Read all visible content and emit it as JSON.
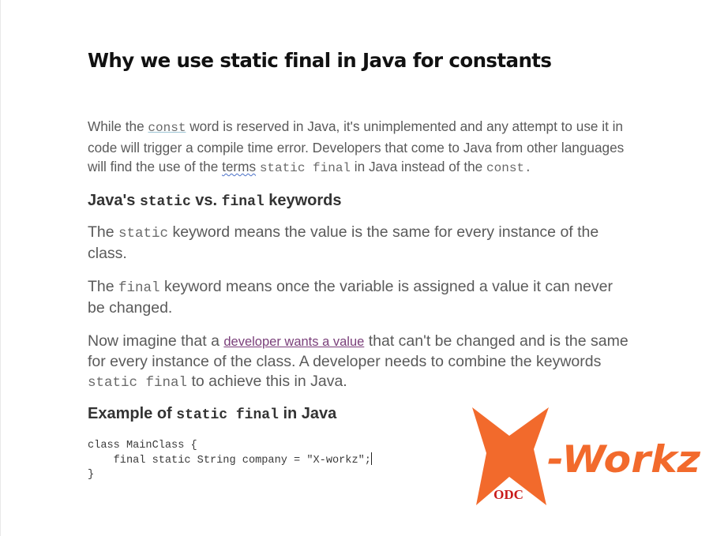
{
  "title": "Why we use static final in Java for constants",
  "intro": {
    "p1": "While the ",
    "const_link": "const",
    "p2": " word is reserved in Java, it's unimplemented and any attempt to use it in code will trigger a compile time error. Developers that come to Java from other languages will find the use of the ",
    "terms": "terms",
    "p3": " ",
    "static_final": "static final",
    "p4": " in Java instead of the ",
    "const_code": "const.",
    "p5": ""
  },
  "section1": {
    "h_prefix": "Java's ",
    "h_static": "static",
    "h_mid": " vs. ",
    "h_final": "final",
    "h_suffix": " keywords",
    "static_para": {
      "pre": "The ",
      "code": "static",
      "post": " keyword means the value is the same for every instance of the class."
    },
    "final_para": {
      "pre": "The ",
      "code": "final",
      "post": " keyword means once the variable is assigned a value it can never be changed."
    },
    "imagine_para": {
      "pre": "Now imagine that a ",
      "link": "developer wants a value",
      "mid": " that can't be changed and is the same for every instance of the class. A developer needs to combine the keywords ",
      "code": "static final",
      "post": " to achieve this in Java."
    }
  },
  "section2": {
    "h_prefix": "Example of ",
    "h_code": "static final",
    "h_suffix": " in Java",
    "code_line1": "class MainClass {",
    "code_line2": "    final static String company = \"X-workz\";",
    "code_line3": "}"
  },
  "logo": {
    "brand_text": "-Workz",
    "badge_text": "ODC",
    "colors": {
      "primary": "#f26a2c",
      "badge_text": "#c81a1a"
    }
  }
}
